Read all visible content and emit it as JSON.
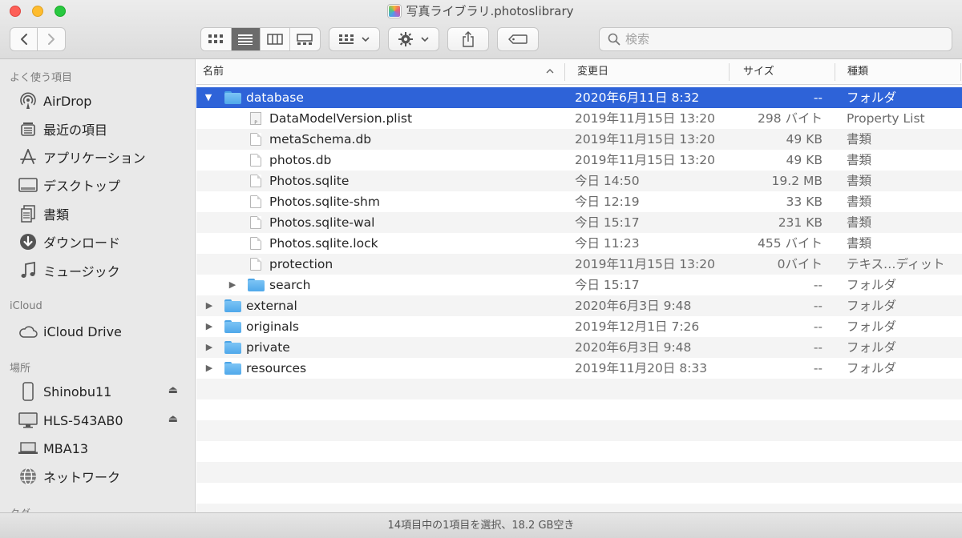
{
  "window": {
    "title": "写真ライブラリ.photoslibrary"
  },
  "toolbar": {
    "back_icon": "chevron-left-icon",
    "forward_icon": "chevron-right-icon",
    "search_placeholder": "検索"
  },
  "sidebar": {
    "favorites_header": "よく使う項目",
    "favorites": [
      {
        "label": "AirDrop",
        "icon": "airdrop-icon"
      },
      {
        "label": "最近の項目",
        "icon": "recents-icon"
      },
      {
        "label": "アプリケーション",
        "icon": "applications-icon"
      },
      {
        "label": "デスクトップ",
        "icon": "desktop-icon"
      },
      {
        "label": "書類",
        "icon": "documents-icon"
      },
      {
        "label": "ダウンロード",
        "icon": "downloads-icon"
      },
      {
        "label": "ミュージック",
        "icon": "music-icon"
      }
    ],
    "icloud_header": "iCloud",
    "icloud": [
      {
        "label": "iCloud Drive",
        "icon": "cloud-icon"
      }
    ],
    "locations_header": "場所",
    "locations": [
      {
        "label": "Shinobu11",
        "icon": "iphone-icon",
        "eject": true
      },
      {
        "label": "HLS-543AB0",
        "icon": "display-icon",
        "eject": true
      },
      {
        "label": "MBA13",
        "icon": "laptop-icon",
        "eject": false
      },
      {
        "label": "ネットワーク",
        "icon": "network-icon",
        "eject": false
      }
    ],
    "tags_header": "タグ"
  },
  "columns": {
    "name": "名前",
    "date": "変更日",
    "size": "サイズ",
    "kind": "種類"
  },
  "files": [
    {
      "name": "database",
      "date": "2020年6月11日 8:32",
      "size": "--",
      "kind": "フォルダ",
      "type": "folder",
      "level": 0,
      "expanded": true,
      "selected": true
    },
    {
      "name": "DataModelVersion.plist",
      "date": "2019年11月15日 13:20",
      "size": "298 バイト",
      "kind": "Property List",
      "type": "plist",
      "level": 1
    },
    {
      "name": "metaSchema.db",
      "date": "2019年11月15日 13:20",
      "size": "49 KB",
      "kind": "書類",
      "type": "doc",
      "level": 1
    },
    {
      "name": "photos.db",
      "date": "2019年11月15日 13:20",
      "size": "49 KB",
      "kind": "書類",
      "type": "doc",
      "level": 1
    },
    {
      "name": "Photos.sqlite",
      "date": "今日 14:50",
      "size": "19.2 MB",
      "kind": "書類",
      "type": "doc",
      "level": 1
    },
    {
      "name": "Photos.sqlite-shm",
      "date": "今日 12:19",
      "size": "33 KB",
      "kind": "書類",
      "type": "doc",
      "level": 1
    },
    {
      "name": "Photos.sqlite-wal",
      "date": "今日 15:17",
      "size": "231 KB",
      "kind": "書類",
      "type": "doc",
      "level": 1
    },
    {
      "name": "Photos.sqlite.lock",
      "date": "今日 11:23",
      "size": "455 バイト",
      "kind": "書類",
      "type": "doc",
      "level": 1
    },
    {
      "name": "protection",
      "date": "2019年11月15日 13:20",
      "size": "0バイト",
      "kind": "テキス…ディット",
      "type": "doc",
      "level": 1
    },
    {
      "name": "search",
      "date": "今日 15:17",
      "size": "--",
      "kind": "フォルダ",
      "type": "folder",
      "level": 1,
      "expanded": false
    },
    {
      "name": "external",
      "date": "2020年6月3日 9:48",
      "size": "--",
      "kind": "フォルダ",
      "type": "folder",
      "level": 0,
      "expanded": false
    },
    {
      "name": "originals",
      "date": "2019年12月1日 7:26",
      "size": "--",
      "kind": "フォルダ",
      "type": "folder",
      "level": 0,
      "expanded": false
    },
    {
      "name": "private",
      "date": "2020年6月3日 9:48",
      "size": "--",
      "kind": "フォルダ",
      "type": "folder",
      "level": 0,
      "expanded": false
    },
    {
      "name": "resources",
      "date": "2019年11月20日 8:33",
      "size": "--",
      "kind": "フォルダ",
      "type": "folder",
      "level": 0,
      "expanded": false
    }
  ],
  "status": {
    "text": "14項目中の1項目を選択、18.2 GB空き"
  },
  "colors": {
    "selection": "#2e63d8",
    "folder": "#5aaeee"
  }
}
